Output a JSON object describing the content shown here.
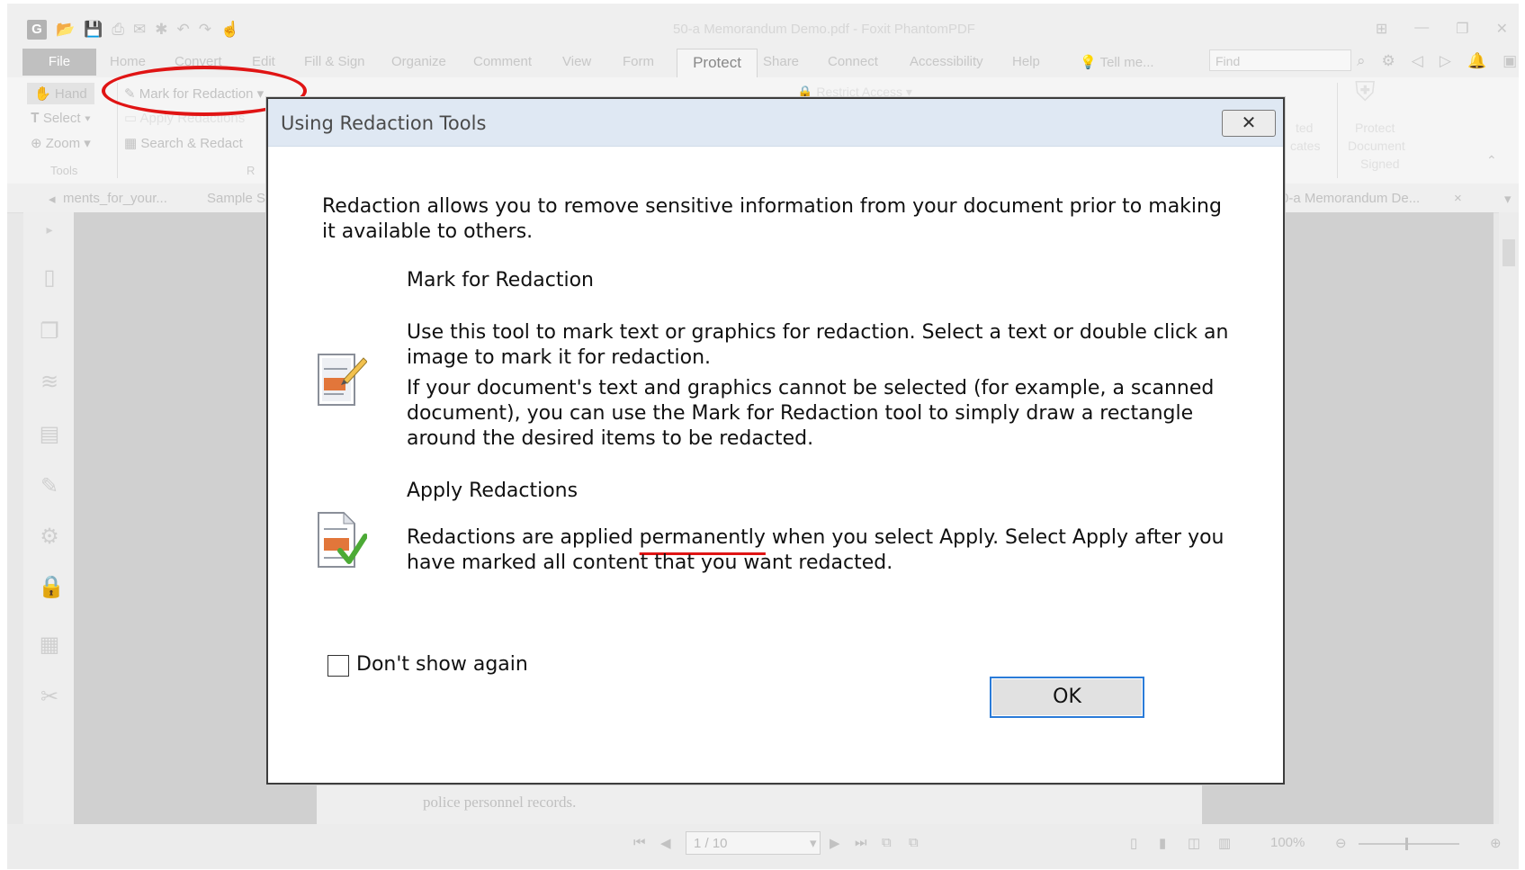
{
  "window": {
    "title": "50-a Memorandum Demo.pdf - Foxit PhantomPDF",
    "controls": [
      "⊞",
      "—",
      "❐",
      "✕"
    ]
  },
  "menu": {
    "file": "File",
    "tabs": [
      "Home",
      "Convert",
      "Edit",
      "Fill & Sign",
      "Organize",
      "Comment",
      "View",
      "Form"
    ],
    "active_tab": "Protect",
    "tabs_right": [
      "Share",
      "Connect",
      "Accessibility",
      "Help"
    ],
    "tell_me": "Tell me...",
    "find_placeholder": "Find"
  },
  "ribbon": {
    "hand": "Hand",
    "select": "Select",
    "zoom": "Zoom",
    "tools_group": "Tools",
    "mark_for_redaction": "Mark for Redaction",
    "apply_redactions": "Apply Redactions",
    "search_redact": "Search & Redact",
    "redaction_group": "R",
    "restrict_access": "Restrict Access",
    "trusted_certificates": [
      "ted",
      "cates"
    ],
    "protect_document": [
      "Protect",
      "Document",
      "Signed"
    ]
  },
  "doc_tabs": {
    "tab1": "ments_for_your...",
    "tab2": "Sample S",
    "tab3": "0-a Memorandum De..."
  },
  "document": {
    "visible_text": "police personnel records."
  },
  "status": {
    "page": "1 / 10",
    "zoom": "100%"
  },
  "dialog": {
    "title": "Using Redaction Tools",
    "close_glyph": "✕",
    "intro": "Redaction allows you to remove sensitive information from your document prior to making it available to others.",
    "mark_heading": "Mark for Redaction",
    "mark_text1": "Use this tool to mark text or graphics for redaction. Select a text or double click an image to mark it for redaction.",
    "mark_text2": "If your document's text and graphics cannot be selected (for example, a scanned document), you can use the Mark for Redaction tool to simply draw a rectangle around the desired items to be redacted.",
    "apply_heading": "Apply Redactions",
    "apply_text_before": "Redactions are applied ",
    "apply_text_highlight": "permanently",
    "apply_text_after": " when you select Apply. Select Apply after you have marked all content that you want redacted.",
    "dont_show": "Don't show again",
    "ok": "OK"
  },
  "colors": {
    "annotation_red": "#e01414",
    "ok_border": "#2a7bd8",
    "dialog_titlebar": "#dfe8f3"
  }
}
